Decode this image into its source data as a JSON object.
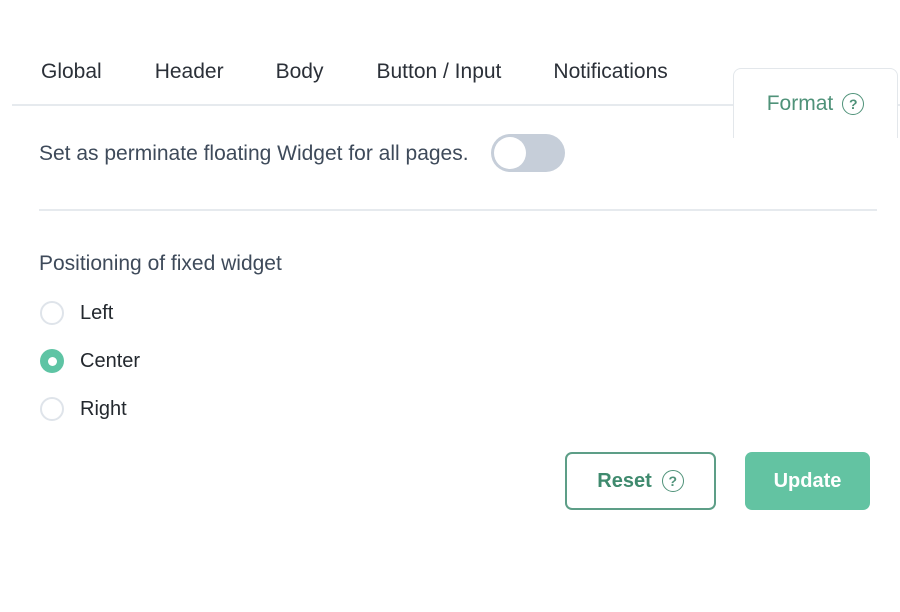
{
  "tabs": {
    "items": [
      {
        "label": "Global",
        "active": false
      },
      {
        "label": "Header",
        "active": false
      },
      {
        "label": "Body",
        "active": false
      },
      {
        "label": "Button / Input",
        "active": false
      },
      {
        "label": "Notifications",
        "active": false
      },
      {
        "label": "Format",
        "active": true,
        "help_icon": "help-circle-icon",
        "help_glyph": "?"
      }
    ]
  },
  "floating_widget": {
    "label": "Set as perminate floating Widget for all pages.",
    "toggle_state": "off"
  },
  "positioning": {
    "label": "Positioning of fixed widget",
    "options": [
      {
        "label": "Left",
        "selected": false
      },
      {
        "label": "Center",
        "selected": true
      },
      {
        "label": "Right",
        "selected": false
      }
    ],
    "selected_value": "Center"
  },
  "actions": {
    "reset_label": "Reset",
    "reset_help_icon": "help-circle-icon",
    "reset_help_glyph": "?",
    "update_label": "Update"
  },
  "colors": {
    "accent_green": "#63c3a2",
    "tab_active_text": "#4f9279",
    "button_outline": "#5d9e87",
    "toggle_track_off": "#c6ced9",
    "divider": "#e6eaee",
    "text_primary": "#23282e",
    "text_muted": "#3e4a5a"
  }
}
